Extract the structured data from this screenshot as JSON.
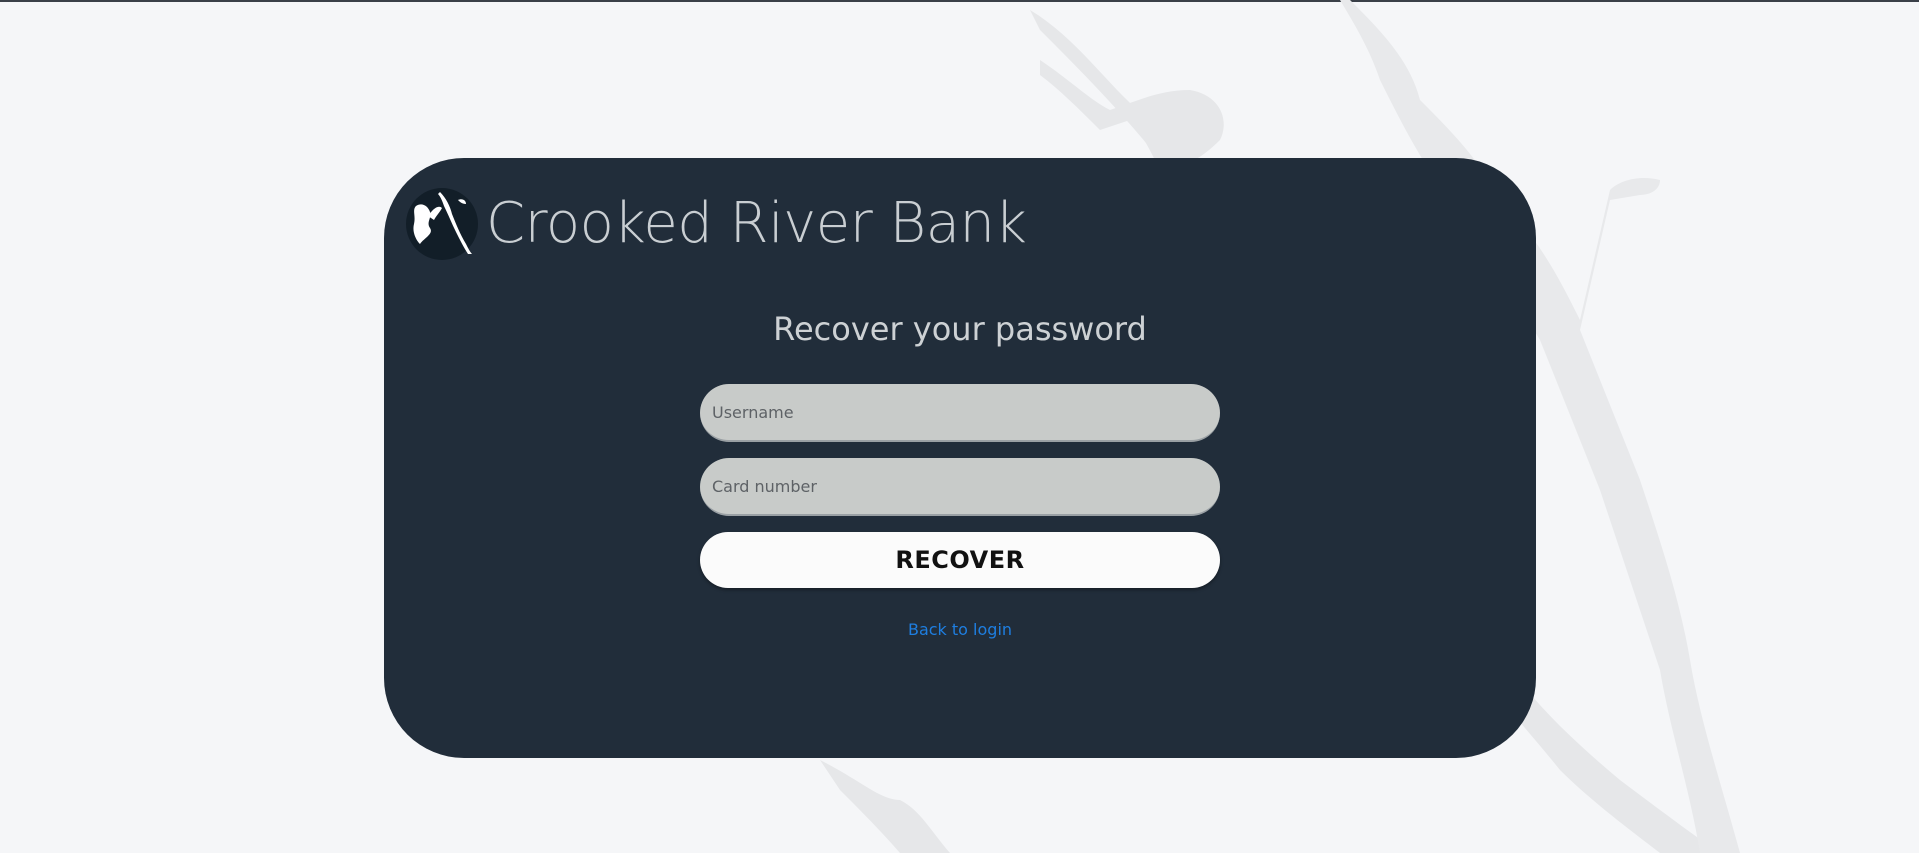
{
  "brand": {
    "name": "Crooked River Bank",
    "logo_icon": "river-logo-icon"
  },
  "form": {
    "title": "Recover your password",
    "username_placeholder": "Username",
    "card_placeholder": "Card number",
    "recover_label": "RECOVER",
    "back_link": "Back to login"
  },
  "colors": {
    "card_bg": "#212d3a",
    "page_bg": "#f5f6f8",
    "field_bg": "#c8cbc9",
    "link": "#1e7ee0"
  }
}
